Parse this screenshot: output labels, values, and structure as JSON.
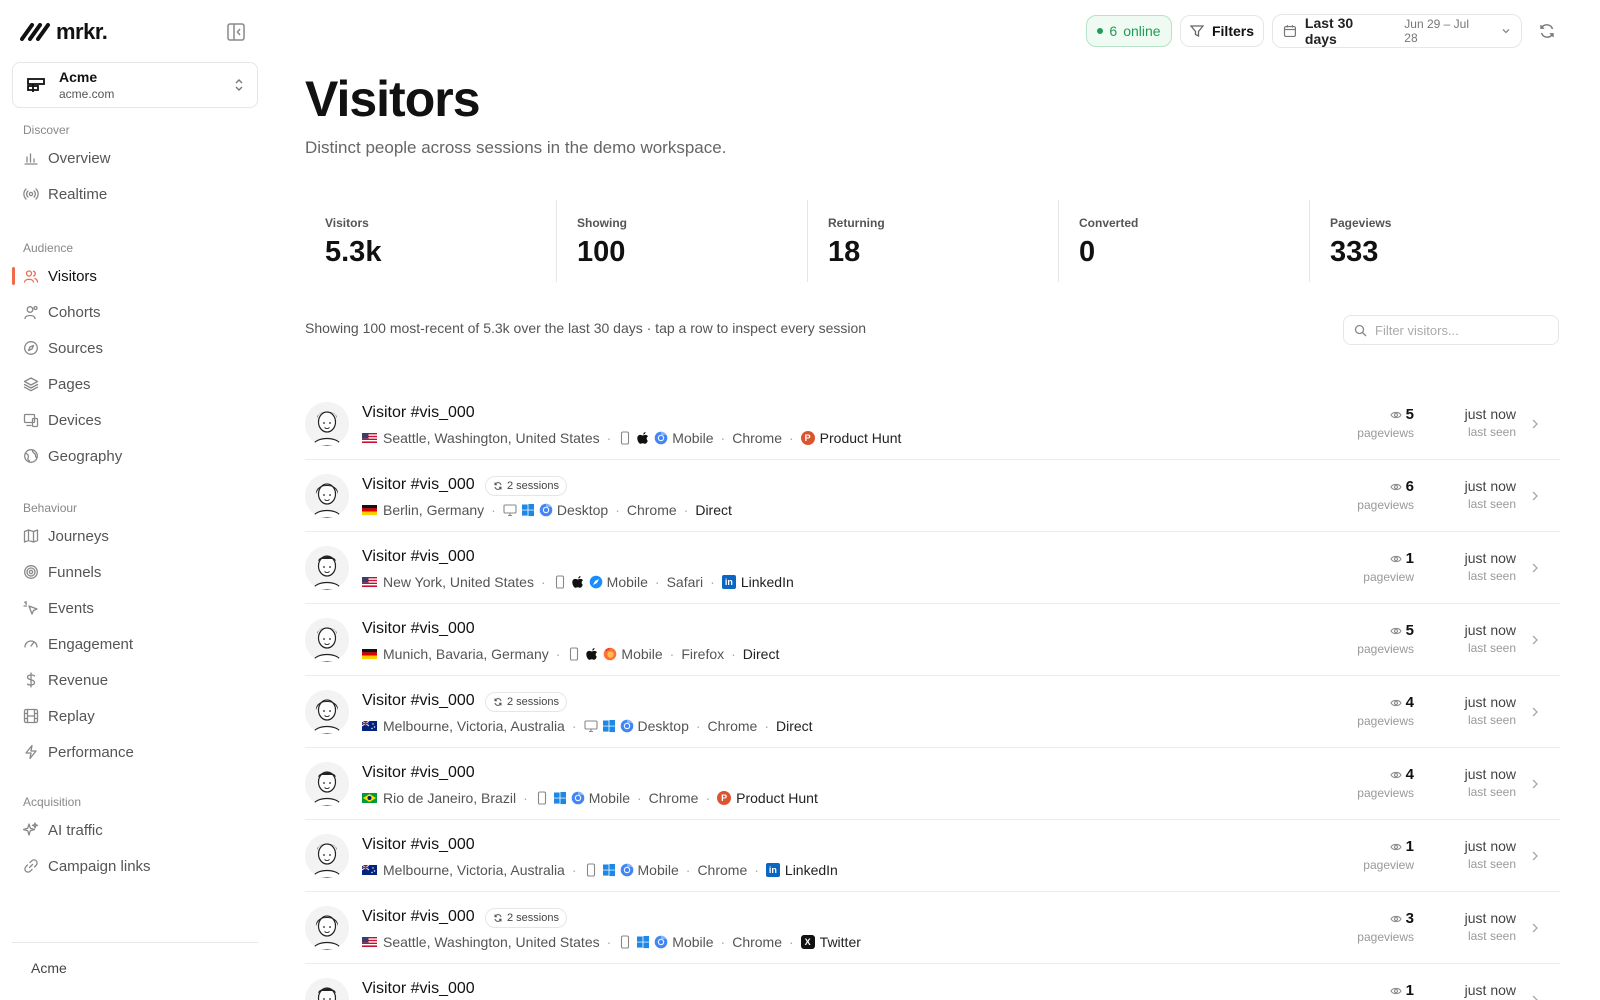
{
  "app": {
    "logo_text": "mrkr."
  },
  "workspace": {
    "name": "Acme",
    "domain": "acme.com"
  },
  "nav": [
    {
      "heading": "Discover",
      "items": [
        {
          "label": "Overview",
          "icon": "bar-chart-icon"
        },
        {
          "label": "Realtime",
          "icon": "broadcast-icon"
        }
      ]
    },
    {
      "heading": "Audience",
      "items": [
        {
          "label": "Visitors",
          "icon": "users-icon",
          "active": true
        },
        {
          "label": "Cohorts",
          "icon": "user-group-icon"
        },
        {
          "label": "Sources",
          "icon": "compass-icon"
        },
        {
          "label": "Pages",
          "icon": "layers-icon"
        },
        {
          "label": "Devices",
          "icon": "devices-icon"
        },
        {
          "label": "Geography",
          "icon": "globe-icon"
        }
      ]
    },
    {
      "heading": "Behaviour",
      "items": [
        {
          "label": "Journeys",
          "icon": "map-icon"
        },
        {
          "label": "Funnels",
          "icon": "target-icon"
        },
        {
          "label": "Events",
          "icon": "pointer-icon"
        },
        {
          "label": "Engagement",
          "icon": "gauge-icon"
        },
        {
          "label": "Revenue",
          "icon": "dollar-icon"
        },
        {
          "label": "Replay",
          "icon": "film-icon"
        },
        {
          "label": "Performance",
          "icon": "bolt-icon"
        }
      ]
    },
    {
      "heading": "Acquisition",
      "items": [
        {
          "label": "AI traffic",
          "icon": "sparkles-icon"
        },
        {
          "label": "Campaign links",
          "icon": "link-icon"
        }
      ]
    }
  ],
  "sidebar_footer": "Acme",
  "topbar": {
    "online_count": "6",
    "online_label": "online",
    "filters_label": "Filters",
    "date_label": "Last 30 days",
    "date_range": "Jun 29 – Jul 28"
  },
  "page": {
    "title": "Visitors",
    "subtitle": "Distinct people across sessions in the demo workspace."
  },
  "stats": [
    {
      "label": "Visitors",
      "value": "5.3k"
    },
    {
      "label": "Showing",
      "value": "100"
    },
    {
      "label": "Returning",
      "value": "18"
    },
    {
      "label": "Converted",
      "value": "0"
    },
    {
      "label": "Pageviews",
      "value": "333"
    }
  ],
  "showing_note": "Showing 100 most-recent of 5.3k over the last 30 days · tap a row to inspect every session",
  "filter": {
    "placeholder": "Filter visitors..."
  },
  "visitors": [
    {
      "name": "Visitor #vis_000",
      "sessions": "",
      "location": "Seattle, Washington, United States",
      "flag": "us",
      "device": "mobile",
      "os": "apple",
      "browser": "chrome",
      "device_label": "Mobile",
      "browser_label": "Chrome",
      "source": "Product Hunt",
      "source_icon": "producthunt",
      "pageviews": "5",
      "pageviews_label": "pageviews",
      "last_seen": "just now",
      "last_seen_label": "last seen"
    },
    {
      "name": "Visitor #vis_000",
      "sessions": "2 sessions",
      "location": "Berlin, Germany",
      "flag": "de",
      "device": "desktop",
      "os": "windows",
      "browser": "chrome",
      "device_label": "Desktop",
      "browser_label": "Chrome",
      "source": "Direct",
      "source_icon": "",
      "pageviews": "6",
      "pageviews_label": "pageviews",
      "last_seen": "just now",
      "last_seen_label": "last seen"
    },
    {
      "name": "Visitor #vis_000",
      "sessions": "",
      "location": "New York, United States",
      "flag": "us",
      "device": "mobile",
      "os": "apple",
      "browser": "safari",
      "device_label": "Mobile",
      "browser_label": "Safari",
      "source": "LinkedIn",
      "source_icon": "linkedin",
      "pageviews": "1",
      "pageviews_label": "pageview",
      "last_seen": "just now",
      "last_seen_label": "last seen"
    },
    {
      "name": "Visitor #vis_000",
      "sessions": "",
      "location": "Munich, Bavaria, Germany",
      "flag": "de",
      "device": "mobile",
      "os": "apple",
      "browser": "firefox",
      "device_label": "Mobile",
      "browser_label": "Firefox",
      "source": "Direct",
      "source_icon": "",
      "pageviews": "5",
      "pageviews_label": "pageviews",
      "last_seen": "just now",
      "last_seen_label": "last seen"
    },
    {
      "name": "Visitor #vis_000",
      "sessions": "2 sessions",
      "location": "Melbourne, Victoria, Australia",
      "flag": "au",
      "device": "desktop",
      "os": "windows",
      "browser": "chrome",
      "device_label": "Desktop",
      "browser_label": "Chrome",
      "source": "Direct",
      "source_icon": "",
      "pageviews": "4",
      "pageviews_label": "pageviews",
      "last_seen": "just now",
      "last_seen_label": "last seen"
    },
    {
      "name": "Visitor #vis_000",
      "sessions": "",
      "location": "Rio de Janeiro, Brazil",
      "flag": "br",
      "device": "mobile",
      "os": "windows",
      "browser": "chrome",
      "device_label": "Mobile",
      "browser_label": "Chrome",
      "source": "Product Hunt",
      "source_icon": "producthunt",
      "pageviews": "4",
      "pageviews_label": "pageviews",
      "last_seen": "just now",
      "last_seen_label": "last seen"
    },
    {
      "name": "Visitor #vis_000",
      "sessions": "",
      "location": "Melbourne, Victoria, Australia",
      "flag": "au",
      "device": "mobile",
      "os": "windows",
      "browser": "chrome",
      "device_label": "Mobile",
      "browser_label": "Chrome",
      "source": "LinkedIn",
      "source_icon": "linkedin",
      "pageviews": "1",
      "pageviews_label": "pageview",
      "last_seen": "just now",
      "last_seen_label": "last seen"
    },
    {
      "name": "Visitor #vis_000",
      "sessions": "2 sessions",
      "location": "Seattle, Washington, United States",
      "flag": "us",
      "device": "mobile",
      "os": "windows",
      "browser": "chrome",
      "device_label": "Mobile",
      "browser_label": "Chrome",
      "source": "Twitter",
      "source_icon": "x",
      "pageviews": "3",
      "pageviews_label": "pageviews",
      "last_seen": "just now",
      "last_seen_label": "last seen"
    },
    {
      "name": "Visitor #vis_000",
      "sessions": "",
      "location": "",
      "flag": "",
      "device": "",
      "os": "",
      "browser": "",
      "device_label": "",
      "browser_label": "",
      "source": "",
      "source_icon": "",
      "pageviews": "1",
      "pageviews_label": "",
      "last_seen": "just now",
      "last_seen_label": ""
    }
  ],
  "colors": {
    "accent": "#f26a4b",
    "online": "#1f9d55",
    "chrome": "#4285f4",
    "producthunt": "#da552f",
    "linkedin": "#0a66c2"
  }
}
